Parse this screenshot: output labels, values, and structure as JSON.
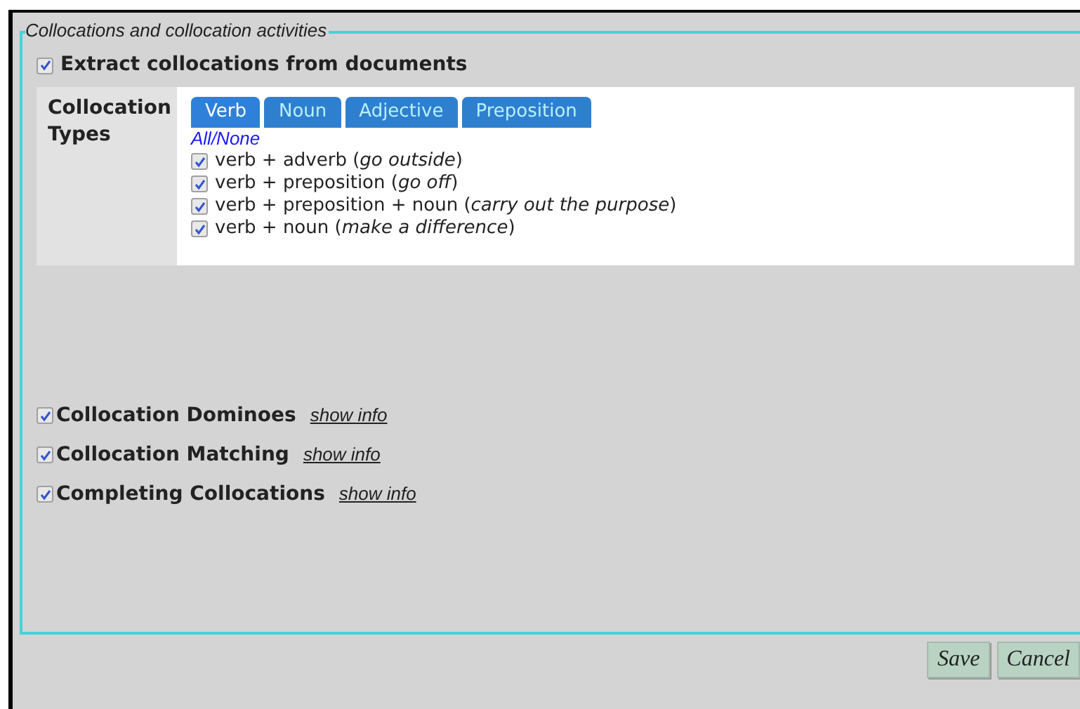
{
  "legend": "Collocations and collocation activities",
  "extract": {
    "label": "Extract collocations from documents",
    "checked": true
  },
  "types": {
    "label": "Collocation Types",
    "tabs": [
      {
        "label": "Verb",
        "selected": true
      },
      {
        "label": "Noun",
        "selected": false
      },
      {
        "label": "Adjective",
        "selected": false
      },
      {
        "label": "Preposition",
        "selected": false
      }
    ],
    "all_none": "All/None",
    "items": [
      {
        "label": "verb + adverb (*go outside*)",
        "checked": true
      },
      {
        "label": "verb + preposition (*go off*)",
        "checked": true
      },
      {
        "label": "verb + preposition + noun (*carry out the purpose*)",
        "checked": true
      },
      {
        "label": "verb + noun (*make a difference*)",
        "checked": true
      }
    ]
  },
  "activities": [
    {
      "label": "Collocation Dominoes",
      "checked": true,
      "link": "show info"
    },
    {
      "label": "Collocation Matching",
      "checked": true,
      "link": "show info"
    },
    {
      "label": "Completing Collocations",
      "checked": true,
      "link": "show info"
    }
  ],
  "buttons": [
    "Save",
    "Cancel"
  ]
}
